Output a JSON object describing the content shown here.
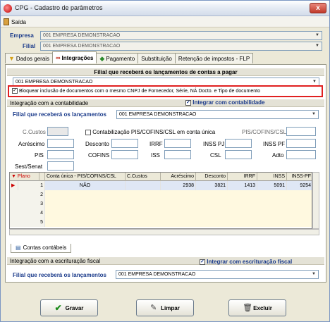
{
  "window": {
    "title": "CPG - Cadastro de parâmetros",
    "close_label": "x"
  },
  "menu": {
    "saida": "Saída"
  },
  "empresa": {
    "label": "Empresa",
    "value": "001 EMPRESA DEMONSTRACAO"
  },
  "filial": {
    "label": "Filial",
    "value": "001 EMPRESA DEMONSTRACAO"
  },
  "tabs": [
    {
      "label": "Dados gerais"
    },
    {
      "label": "Integrações"
    },
    {
      "label": "Pagamento"
    },
    {
      "label": "Substituição"
    },
    {
      "label": "Retenção de impostos - FLP"
    }
  ],
  "filial_lanc": {
    "header": "Filial que receberá os lançamentos de contas a pagar",
    "value": "001 EMPRESA DEMONSTRACAO",
    "bloquear_label": "Bloquear inclusão de documentos com o mesmo CNPJ de Fornecedor, Série, NÁ Docto. e Tipo de documento"
  },
  "integ_contab": {
    "header": "Integração com a contabilidade",
    "check_label": "Integrar com contabilidade",
    "filial_label": "Filial que receberá os lançamentos",
    "filial_value": "001 EMPRESA DEMONSTRACAO"
  },
  "fields": {
    "ccustos": "C.Custos",
    "contabilizacao": "Contabilização PIS/COFINS/CSL em conta única",
    "pis_cofins_csl": "PIS/COFINS/CSL",
    "acrescimo": "Acréscimo",
    "desconto": "Desconto",
    "irrf": "IRRF",
    "inss_pj": "INSS PJ",
    "inss_pf": "INSS PF",
    "pis": "PIS",
    "cofins": "COFINS",
    "iss": "ISS",
    "csl": "CSL",
    "adto": "Adto",
    "sest_senat": "Sest/Senat"
  },
  "grid": {
    "columns": [
      "Plano",
      "Conta única - PIS/COFINS/CSL",
      "C.Custos",
      "Acréscimo",
      "Desconto",
      "IRRF",
      "INSS",
      "INSS-PF"
    ],
    "rows": [
      {
        "n": "1",
        "conta": "NÃO",
        "ccustos": "",
        "acrescimo": "2938",
        "desconto": "3821",
        "irrf": "1413",
        "inss": "5091",
        "inss_pf": "9254"
      },
      {
        "n": "2",
        "conta": "",
        "ccustos": "",
        "acrescimo": "",
        "desconto": "",
        "irrf": "",
        "inss": "",
        "inss_pf": ""
      },
      {
        "n": "3",
        "conta": "",
        "ccustos": "",
        "acrescimo": "",
        "desconto": "",
        "irrf": "",
        "inss": "",
        "inss_pf": ""
      },
      {
        "n": "4",
        "conta": "",
        "ccustos": "",
        "acrescimo": "",
        "desconto": "",
        "irrf": "",
        "inss": "",
        "inss_pf": ""
      },
      {
        "n": "5",
        "conta": "",
        "ccustos": "",
        "acrescimo": "",
        "desconto": "",
        "irrf": "",
        "inss": "",
        "inss_pf": ""
      }
    ]
  },
  "subtab": {
    "label": "Contas contábeis"
  },
  "integ_fiscal": {
    "header": "Integração com a escrituração fiscal",
    "check_label": "Integrar com escrituração fiscal",
    "filial_label": "Filial que receberá os lançamentos",
    "filial_value": "001 EMPRESA DEMONSTRACAO"
  },
  "buttons": {
    "gravar": "Gravar",
    "limpar": "Limpar",
    "excluir": "Excluir"
  }
}
